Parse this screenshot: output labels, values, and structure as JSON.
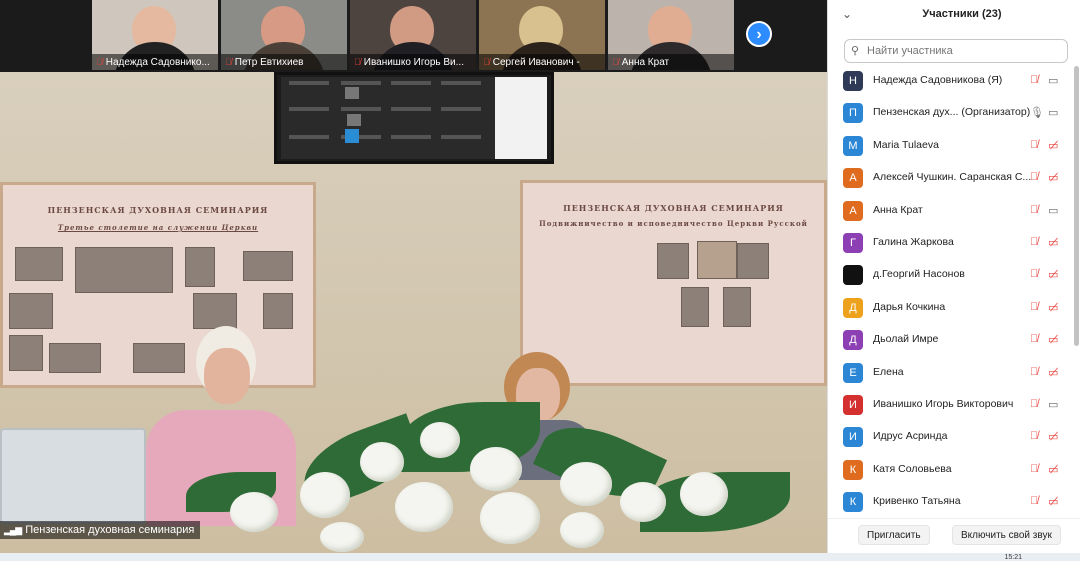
{
  "thumbnails": [
    {
      "name": "Надежда Садовнико...",
      "skin": "#e4b9a0",
      "cloth": "#222",
      "bg": "#cfc7bd"
    },
    {
      "name": "Петр Евтихиев",
      "skin": "#d79a84",
      "cloth": "#4a4038",
      "bg": "#8b8c87"
    },
    {
      "name": "Иванишко Игорь Ви...",
      "skin": "#d19a83",
      "cloth": "#1f1f24",
      "bg": "#4d4440"
    },
    {
      "name": "Сергей   Иванович -",
      "skin": "#d8c08f",
      "cloth": "#2b231b",
      "bg": "#8c7351"
    },
    {
      "name": "Анна Крат",
      "skin": "#e0ad92",
      "cloth": "#2e2a2c",
      "bg": "#bdb3ad"
    }
  ],
  "next_icon": "›",
  "speaker_label": "Пензенская духовная семинария",
  "tv_screen_text": [
    "Надежда",
    "Пензенская",
    "Иванишко",
    "Сергей",
    "Анна"
  ],
  "posters": [
    {
      "title": "ПЕНЗЕНСКАЯ ДУХОВНАЯ СЕМИНАРИЯ",
      "subtitle": "Третье столетие на служении Церкви"
    },
    {
      "title": "ПЕНЗЕНСКАЯ ДУХОВНАЯ СЕМИНАРИЯ",
      "subtitle": "Подвижничество и исповедничество Церкви Русской"
    }
  ],
  "panel": {
    "collapse_icon": "⌄",
    "title": "Участники (23)",
    "search_placeholder": "Найти участника",
    "search_icon": "⚲",
    "participants": [
      {
        "initial": "Н",
        "name": "Надежда Садовникова (Я)",
        "color": "#2f3b56",
        "mic": "off",
        "cam": "on"
      },
      {
        "initial": "П",
        "name": "Пензенская дух...  (Организатор)",
        "color": "#2b86d6",
        "mic": "on",
        "cam": "on"
      },
      {
        "initial": "M",
        "name": "Maria Tulaeva",
        "color": "#2b86d6",
        "mic": "off",
        "cam": "off"
      },
      {
        "initial": "А",
        "name": "Алексей Чушкин. Саранская С...",
        "color": "#df6b1f",
        "mic": "off",
        "cam": "off"
      },
      {
        "initial": "А",
        "name": "Анна Крат",
        "color": "#df6b1f",
        "mic": "off",
        "cam": "on"
      },
      {
        "initial": "Г",
        "name": "Галина Жаркова",
        "color": "#8d3fb4",
        "mic": "off",
        "cam": "off"
      },
      {
        "initial": "",
        "name": "д.Георгий Насонов",
        "color": "#111111",
        "mic": "off",
        "cam": "off"
      },
      {
        "initial": "Д",
        "name": "Дарья Кочкина",
        "color": "#eea21b",
        "mic": "off",
        "cam": "off"
      },
      {
        "initial": "Д",
        "name": "Дьолай Имре",
        "color": "#8d3fb4",
        "mic": "off",
        "cam": "off"
      },
      {
        "initial": "Е",
        "name": "Елена",
        "color": "#2b86d6",
        "mic": "off",
        "cam": "off"
      },
      {
        "initial": "И",
        "name": "Иванишко Игорь Викторович",
        "color": "#d43030",
        "mic": "off",
        "cam": "on"
      },
      {
        "initial": "И",
        "name": "Идрус Асринда",
        "color": "#2b86d6",
        "mic": "off",
        "cam": "off"
      },
      {
        "initial": "К",
        "name": "Катя Соловьева",
        "color": "#df6b1f",
        "mic": "off",
        "cam": "off"
      },
      {
        "initial": "К",
        "name": "Кривенко Татьяна",
        "color": "#2b86d6",
        "mic": "off",
        "cam": "off"
      }
    ],
    "invite_label": "Пригласить",
    "unmute_label": "Включить свой звук"
  },
  "taskbar": {
    "clock": "15:21"
  },
  "icons": {
    "mic_off": "mic-off-icon",
    "mic_on": "mic-icon",
    "cam_off": "video-off-icon",
    "cam_on": "video-icon"
  }
}
